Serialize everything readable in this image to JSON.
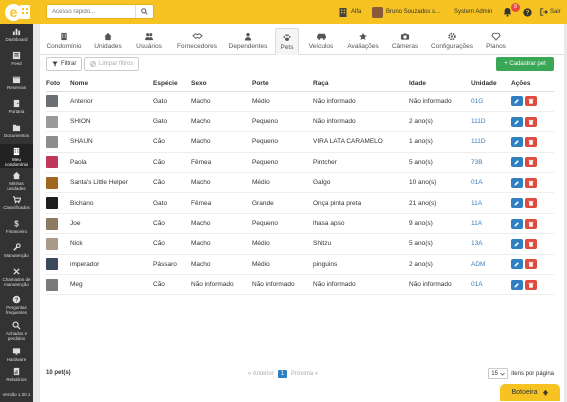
{
  "topbar": {
    "search_placeholder": "Acesso rápido...",
    "condo_name": "Alfa",
    "user_name": "Bruno Souzados s...",
    "role": "System Admin",
    "notifications": "8",
    "logout_label": "Sair"
  },
  "sidebar": {
    "items": [
      {
        "label": "Dashboard",
        "icon": "dashboard-icon"
      },
      {
        "label": "Feed",
        "icon": "feed-icon"
      },
      {
        "label": "Reservas",
        "icon": "calendar-icon"
      },
      {
        "label": "Portaria",
        "icon": "door-icon"
      },
      {
        "label": "Documentos",
        "icon": "folder-icon"
      },
      {
        "label": "Meu condomínio",
        "icon": "building-icon"
      },
      {
        "label": "Minhas unidades",
        "icon": "home-icon"
      },
      {
        "label": "Classificados",
        "icon": "cart-icon"
      },
      {
        "label": "Financeiro",
        "icon": "dollar-icon"
      },
      {
        "label": "Manutenção",
        "icon": "wrench-icon"
      },
      {
        "label": "Chamados de manutenção",
        "icon": "tools-icon"
      },
      {
        "label": "Perguntas frequentes",
        "icon": "question-icon"
      },
      {
        "label": "Achados e perdidos",
        "icon": "search-icon"
      },
      {
        "label": "Hardware",
        "icon": "monitor-icon"
      },
      {
        "label": "Relatórios",
        "icon": "report-icon"
      },
      {
        "label": "Versão 1.30.1",
        "icon": ""
      }
    ]
  },
  "tabs": [
    {
      "label": "Condomínio",
      "icon": "building-icon"
    },
    {
      "label": "Unidades",
      "icon": "home-icon"
    },
    {
      "label": "Usuários",
      "icon": "users-icon"
    },
    {
      "label": "Fornecedores",
      "icon": "handshake-icon"
    },
    {
      "label": "Dependentes",
      "icon": "dependents-icon"
    },
    {
      "label": "Pets",
      "icon": "paw-icon"
    },
    {
      "label": "Veículos",
      "icon": "car-icon"
    },
    {
      "label": "Avaliações",
      "icon": "star-icon"
    },
    {
      "label": "Câmeras",
      "icon": "camera-icon"
    },
    {
      "label": "Configurações",
      "icon": "gear-icon"
    },
    {
      "label": "Planos",
      "icon": "diamond-icon"
    }
  ],
  "toolbar": {
    "filter_label": "Filtrar",
    "clear_label": "Limpar filtros",
    "add_label": "+ Cadastrar pet"
  },
  "table": {
    "headers": [
      "Foto",
      "Nome",
      "Espécie",
      "Sexo",
      "Porte",
      "Raça",
      "Idade",
      "Unidade",
      "Ações"
    ],
    "rows": [
      {
        "nome": "Antenor",
        "especie": "Gato",
        "sexo": "Macho",
        "porte": "Médio",
        "raca": "Não informado",
        "idade": "Não informado",
        "unidade": "01G",
        "photo": "#6b6f73"
      },
      {
        "nome": "SHION",
        "especie": "Gato",
        "sexo": "Macho",
        "porte": "Pequeno",
        "raca": "Não informado",
        "idade": "2 ano(s)",
        "unidade": "111D",
        "photo": "#9a9a9a"
      },
      {
        "nome": "SHAUN",
        "especie": "Cão",
        "sexo": "Macho",
        "porte": "Pequeno",
        "raca": "VIRA LATA CARAMELO",
        "idade": "1 ano(s)",
        "unidade": "111D",
        "photo": "#8d8d8d"
      },
      {
        "nome": "Paola",
        "especie": "Cão",
        "sexo": "Fêmea",
        "porte": "Pequeno",
        "raca": "Pintcher",
        "idade": "5 ano(s)",
        "unidade": "73B",
        "photo": "#c0395a"
      },
      {
        "nome": "Santa's Little Helper",
        "especie": "Cão",
        "sexo": "Macho",
        "porte": "Médio",
        "raca": "Galgo",
        "idade": "10 ano(s)",
        "unidade": "01A",
        "photo": "#a0661f"
      },
      {
        "nome": "Bichano",
        "especie": "Gato",
        "sexo": "Fêmea",
        "porte": "Grande",
        "raca": "Onça pinta preta",
        "idade": "21 ano(s)",
        "unidade": "11A",
        "photo": "#1e1e1e"
      },
      {
        "nome": "Joe",
        "especie": "Cão",
        "sexo": "Macho",
        "porte": "Pequeno",
        "raca": "lhasa apso",
        "idade": "9 ano(s)",
        "unidade": "11A",
        "photo": "#8a7a62"
      },
      {
        "nome": "Nick",
        "especie": "Cão",
        "sexo": "Macho",
        "porte": "Médio",
        "raca": "Shitzu",
        "idade": "5 ano(s)",
        "unidade": "13A",
        "photo": "#a89a86"
      },
      {
        "nome": "imperador",
        "especie": "Pássaro",
        "sexo": "Macho",
        "porte": "Médio",
        "raca": "pinguins",
        "idade": "2 ano(s)",
        "unidade": "ADM",
        "photo": "#3a4a5a"
      },
      {
        "nome": "Meg",
        "especie": "Cão",
        "sexo": "Não informado",
        "porte": "Não informado",
        "raca": "Não informado",
        "idade": "Não informado",
        "unidade": "01A",
        "photo": "#7a7a7a"
      }
    ]
  },
  "footer": {
    "count": "10 pet(s)",
    "prev": "« Anterior",
    "page": "1",
    "next": "Próxima »",
    "per_page_value": "15",
    "per_page_label": "itens por página"
  },
  "botoeira": {
    "label": "Botoeira"
  },
  "colors": {
    "accent": "#f6c322",
    "sidebar": "#333333",
    "add": "#3aa757",
    "edit": "#2f7fc1",
    "delete": "#e04b3f",
    "link": "#3b7dbf"
  }
}
